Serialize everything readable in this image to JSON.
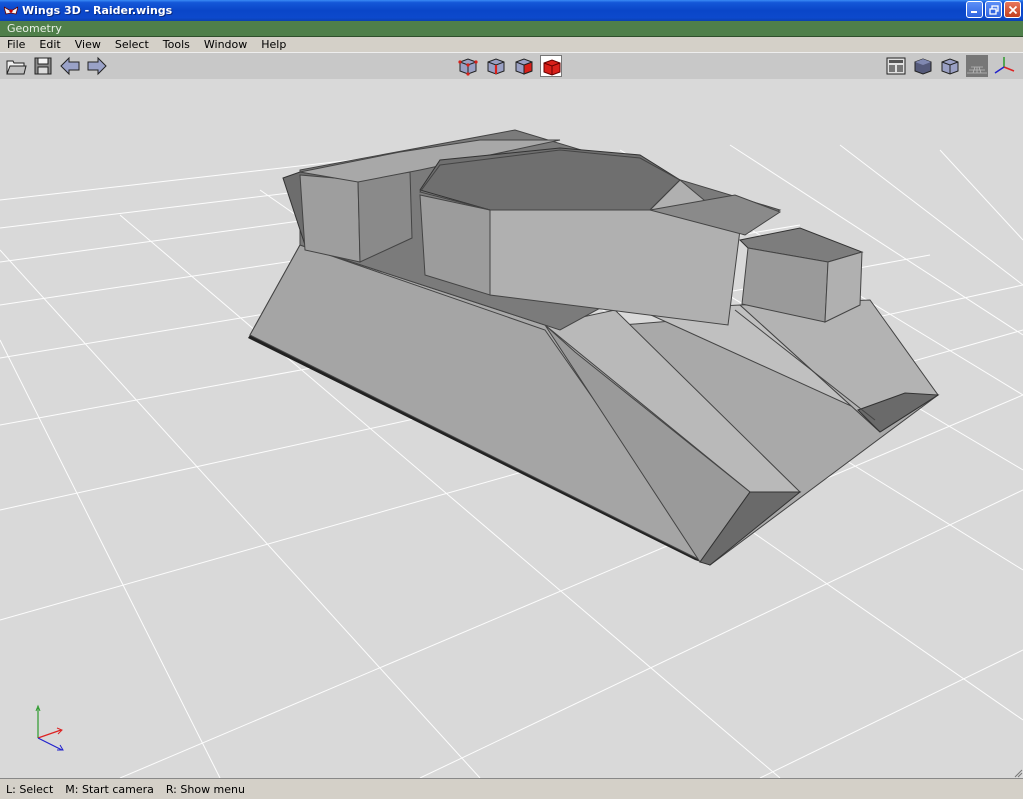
{
  "window": {
    "title": "Wings 3D - Raider.wings"
  },
  "geometry_window": {
    "caption": "Geometry"
  },
  "menubar": {
    "items": [
      "File",
      "Edit",
      "View",
      "Select",
      "Tools",
      "Window",
      "Help"
    ]
  },
  "toolbar": {
    "left_buttons": [
      "open-icon",
      "save-icon",
      "undo-icon",
      "redo-icon"
    ],
    "select_modes": [
      "vertex-mode-icon",
      "edge-mode-icon",
      "face-mode-icon",
      "body-mode-icon"
    ],
    "active_select_mode": "body",
    "right_buttons": [
      "smooth-preview-icon",
      "shaded-icon",
      "wireframe-icon",
      "ground-plane-icon",
      "axes-icon"
    ]
  },
  "statusbar": {
    "hints": [
      "L: Select",
      "M: Start camera",
      "R: Show menu"
    ]
  },
  "colors": {
    "titlebar": "#0a46c8",
    "geometry_caption": "#4f7f4a",
    "viewport_bg": "#d9d9d9",
    "active_mode": "#d9201a"
  }
}
